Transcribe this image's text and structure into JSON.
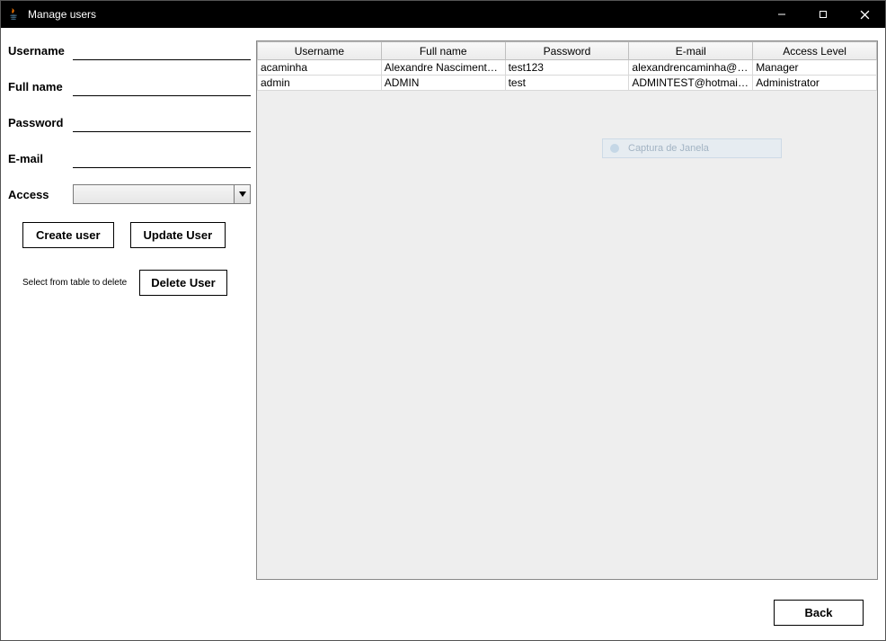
{
  "window": {
    "title": "Manage users"
  },
  "form": {
    "labels": {
      "username": "Username",
      "fullname": "Full name",
      "password": "Password",
      "email": "E-mail",
      "access": "Access"
    },
    "values": {
      "username": "",
      "fullname": "",
      "password": "",
      "email": "",
      "access": ""
    },
    "buttons": {
      "create": "Create user",
      "update": "Update User",
      "delete": "Delete User"
    },
    "delete_hint": "Select from table to delete"
  },
  "table": {
    "headers": [
      "Username",
      "Full name",
      "Password",
      "E-mail",
      "Access Level"
    ],
    "rows": [
      {
        "username": "acaminha",
        "fullname": "Alexandre Nascimento ...",
        "password": "test123",
        "email": "alexandrencaminha@g...",
        "access": "Manager"
      },
      {
        "username": "admin",
        "fullname": "ADMIN",
        "password": "test",
        "email": "ADMINTEST@hotmail....",
        "access": "Administrator"
      }
    ]
  },
  "overlay": {
    "text": "Captura de Janela"
  },
  "footer": {
    "back": "Back"
  }
}
